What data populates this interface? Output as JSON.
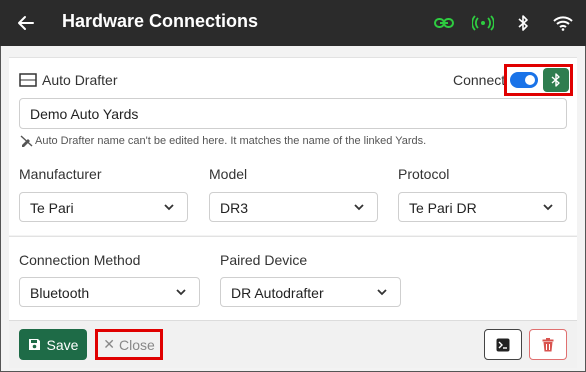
{
  "header": {
    "title": "Hardware Connections",
    "back_icon": "arrow-left-icon",
    "status_icons": [
      "link-icon",
      "broadcast-icon",
      "bluetooth-icon",
      "wifi-icon"
    ]
  },
  "device": {
    "section_title": "Auto Drafter",
    "connect_label": "Connect",
    "connected": true,
    "name_value": "Demo Auto Yards",
    "name_hint": "Auto Drafter name can't be edited here. It matches the name of the linked Yards."
  },
  "fields": {
    "manufacturer": {
      "label": "Manufacturer",
      "value": "Te Pari"
    },
    "model": {
      "label": "Model",
      "value": "DR3"
    },
    "protocol": {
      "label": "Protocol",
      "value": "Te Pari DR"
    },
    "connection_method": {
      "label": "Connection Method",
      "value": "Bluetooth"
    },
    "paired_device": {
      "label": "Paired Device",
      "value": "DR Autodrafter"
    }
  },
  "footer": {
    "save_label": "Save",
    "close_label": "Close"
  },
  "colors": {
    "appbar": "#2b2b2b",
    "green_status": "#2ecc40",
    "primary_green": "#1e6b47",
    "toggle_blue": "#1a73e8",
    "highlight_red": "#e00000"
  }
}
